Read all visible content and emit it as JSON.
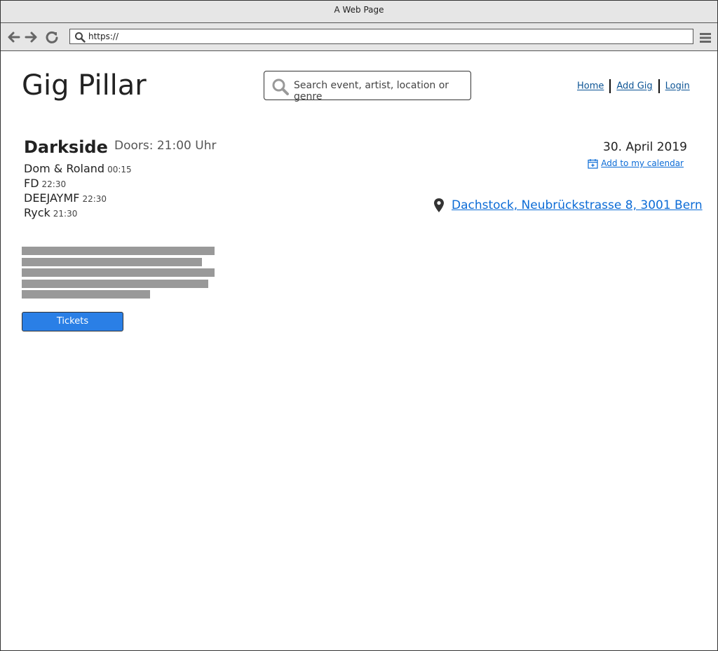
{
  "browser": {
    "window_title": "A Web Page",
    "url": "https://",
    "icons": [
      "back-icon",
      "forward-icon",
      "reload-icon",
      "search-icon",
      "hamburger-menu-icon"
    ]
  },
  "header": {
    "logo": "Gig Pillar",
    "search_placeholder": "Search event, artist, location or genre",
    "nav": {
      "home": "Home",
      "add_gig": "Add Gig",
      "login": "Login"
    }
  },
  "event": {
    "title": "Darkside",
    "doors": "Doors: 21:00 Uhr",
    "lineup": [
      {
        "name": "Dom & Roland",
        "time": "00:15"
      },
      {
        "name": "FD",
        "time": "22:30"
      },
      {
        "name": "DEEJAYMF",
        "time": "22:30"
      },
      {
        "name": "Ryck",
        "time": "21:30"
      }
    ],
    "date": "30. April 2019",
    "calendar_link": "Add to my calendar",
    "location": "Dachstock, Neubrückstrasse 8, 3001 Bern",
    "tickets_label": "Tickets"
  },
  "colors": {
    "link": "#0b6bd6",
    "nav_link": "#0b5394",
    "button": "#2a7fe6",
    "placeholder_text_bar": "#999999"
  }
}
